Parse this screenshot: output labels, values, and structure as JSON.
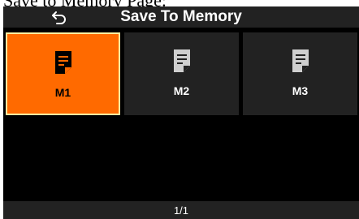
{
  "caption": "Save to Memory Page:",
  "header": {
    "title": "Save To Memory",
    "back_icon": "back-arrow-icon"
  },
  "memory_slots": [
    {
      "label": "M1",
      "icon": "document-icon",
      "selected": true
    },
    {
      "label": "M2",
      "icon": "document-icon",
      "selected": false
    },
    {
      "label": "M3",
      "icon": "document-icon",
      "selected": false
    }
  ],
  "footer": {
    "page_indicator": "1/1"
  },
  "colors": {
    "accent": "#ff6a00",
    "bar": "#222222",
    "background": "#000000"
  }
}
